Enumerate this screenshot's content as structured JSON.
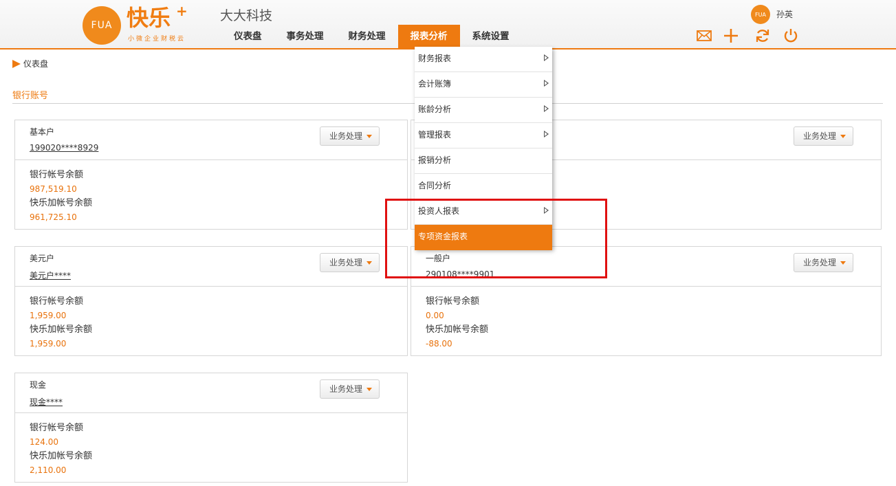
{
  "brand": {
    "logo_badge": "FUA",
    "name": "快乐",
    "plus": "+",
    "slogan": "小微企业财税云",
    "accent_color": "#ee7a10"
  },
  "company": "大大科技",
  "nav": {
    "items": [
      {
        "label": "仪表盘"
      },
      {
        "label": "事务处理"
      },
      {
        "label": "财务处理"
      },
      {
        "label": "报表分析",
        "active": true
      },
      {
        "label": "系统设置"
      }
    ]
  },
  "user": {
    "avatar_text": "FUA",
    "name": "孙英"
  },
  "header_icons": [
    "mail-icon",
    "plus-icon",
    "refresh-icon",
    "power-icon"
  ],
  "breadcrumb": "仪表盘",
  "section_title": "银行账号",
  "button_label": "业务处理",
  "balance_labels": {
    "bank": "银行帐号余额",
    "kuaile": "快乐加帐号余额"
  },
  "cards": [
    {
      "name": "基本户",
      "account": "199020****8929",
      "bank_balance": "987,519.10",
      "kuaile_balance": "961,725.10"
    },
    {
      "name": "一般户",
      "account": "290108****9901",
      "bank_balance": "0.00",
      "kuaile_balance": "-88.00"
    },
    {
      "name": "美元户",
      "account": "美元户****",
      "bank_balance": "1,959.00",
      "kuaile_balance": "1,959.00"
    },
    {
      "name": "现金",
      "account": "现金****",
      "bank_balance": "124.00",
      "kuaile_balance": "2,110.00"
    }
  ],
  "dropdown": {
    "items": [
      {
        "label": "财务报表",
        "submenu": true
      },
      {
        "label": "会计账簿",
        "submenu": true
      },
      {
        "label": "账龄分析",
        "submenu": true
      },
      {
        "label": "管理报表",
        "submenu": true
      },
      {
        "label": "报销分析",
        "submenu": false
      },
      {
        "label": "合同分析",
        "submenu": false
      },
      {
        "label": "投资人报表",
        "submenu": true
      },
      {
        "label": "专项资金报表",
        "submenu": false,
        "active": true
      }
    ]
  }
}
